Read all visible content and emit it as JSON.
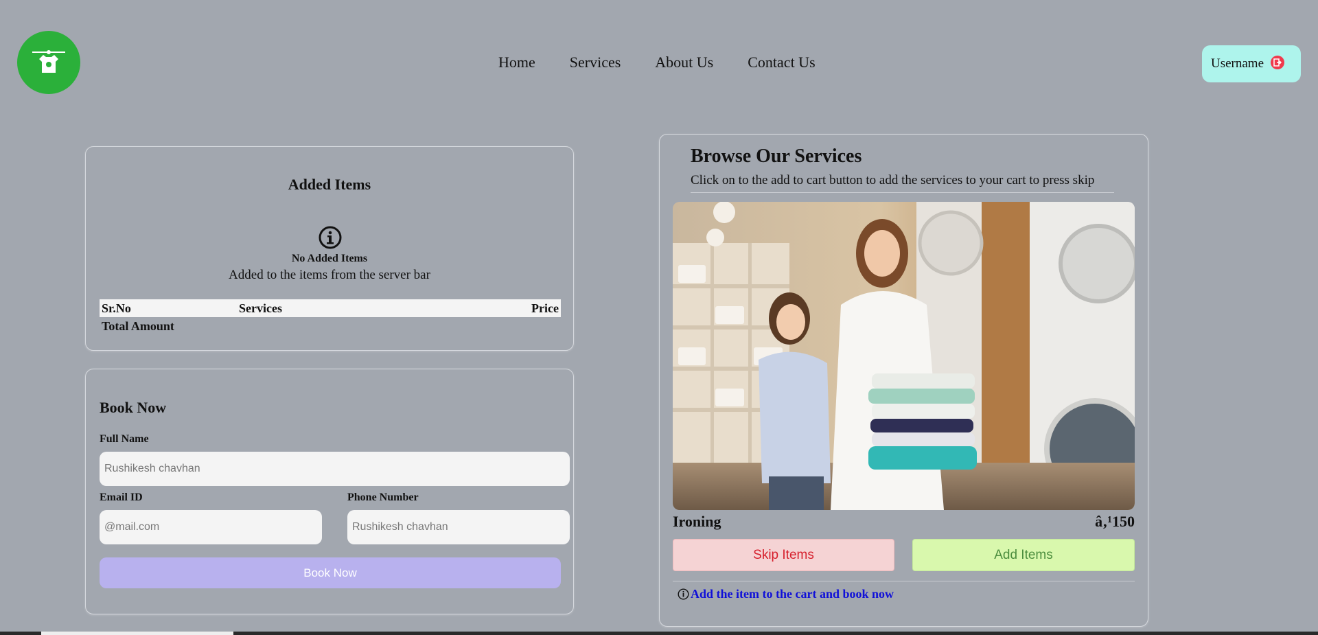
{
  "header": {
    "nav": [
      "Home",
      "Services",
      "About Us",
      "Contact Us"
    ],
    "username": "Username"
  },
  "added_items": {
    "title": "Added Items",
    "empty_title": "No Added Items",
    "empty_subtitle": "Added to the items from the server bar",
    "columns": [
      "Sr.No",
      "Services",
      "Price"
    ],
    "total_label": "Total Amount"
  },
  "book": {
    "title": "Book Now",
    "full_name_label": "Full Name",
    "full_name_placeholder": "Rushikesh chavhan",
    "email_label": "Email ID",
    "email_placeholder": "@mail.com",
    "phone_label": "Phone Number",
    "phone_placeholder": "Rushikesh chavhan",
    "button": "Book Now"
  },
  "browse": {
    "title": "Browse Our Services",
    "subtitle": "Click on to the add to cart button to add the services to your cart to press skip",
    "service_name": "Ironing",
    "service_price": "â‚¹150",
    "skip_button": "Skip Items",
    "add_button": "Add Items",
    "hint": "Add the item to the cart and book now"
  },
  "colors": {
    "background": "#a2a7af",
    "logo": "#2bb03a",
    "user_button": "#aef4ec",
    "book_button": "#b8b1ee",
    "skip_bg": "#f5d3d4",
    "add_bg": "#d9f8ad",
    "hint_text": "#1010d8"
  },
  "icons": [
    "laundry-logo-icon",
    "logout-icon",
    "info-circle-icon"
  ]
}
